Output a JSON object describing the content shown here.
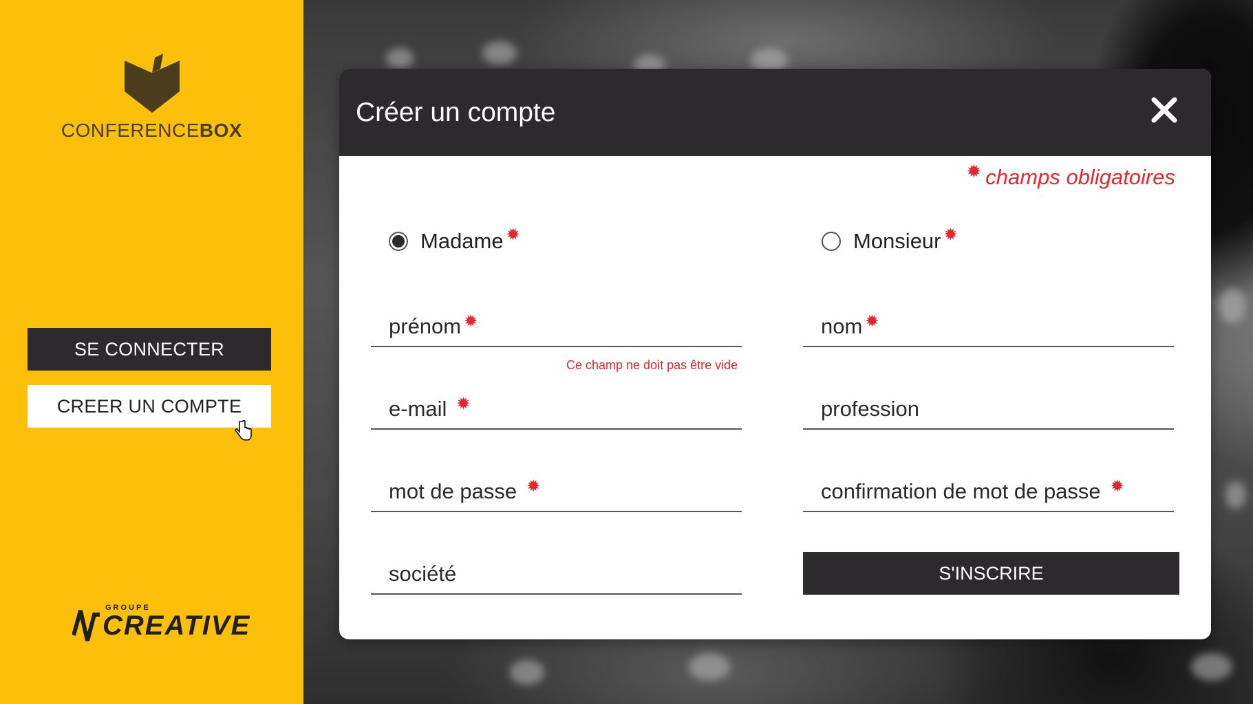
{
  "sidebar": {
    "logo": {
      "part1": "CONFERENCE",
      "part2": "BOX"
    },
    "login_label": "SE CONNECTER",
    "create_label": "CREER UN COMPTE",
    "groupe": {
      "small": "GROUPE",
      "big": "CREATIVE"
    }
  },
  "modal": {
    "title": "Créer un compte",
    "required_note": "champs obligatoires",
    "required_mark": "*",
    "civility": [
      {
        "label": "Madame",
        "selected": true
      },
      {
        "label": "Monsieur",
        "selected": false
      }
    ],
    "fields": {
      "prenom": "prénom",
      "nom": "nom",
      "email": "e-mail",
      "profession": "profession",
      "password": "mot de passe",
      "password_confirm": "confirmation de mot de passe",
      "societe": "société"
    },
    "error_prenom": "Ce champ ne doit pas être vide",
    "submit_label": "S'INSCRIRE"
  },
  "colors": {
    "sidebar": "#fcbf0a",
    "dark": "#2c2a2d",
    "required": "#e5272c"
  },
  "icons": [
    "box-logo-icon",
    "close-icon",
    "hand-cursor-icon",
    "creative-logo-icon"
  ]
}
